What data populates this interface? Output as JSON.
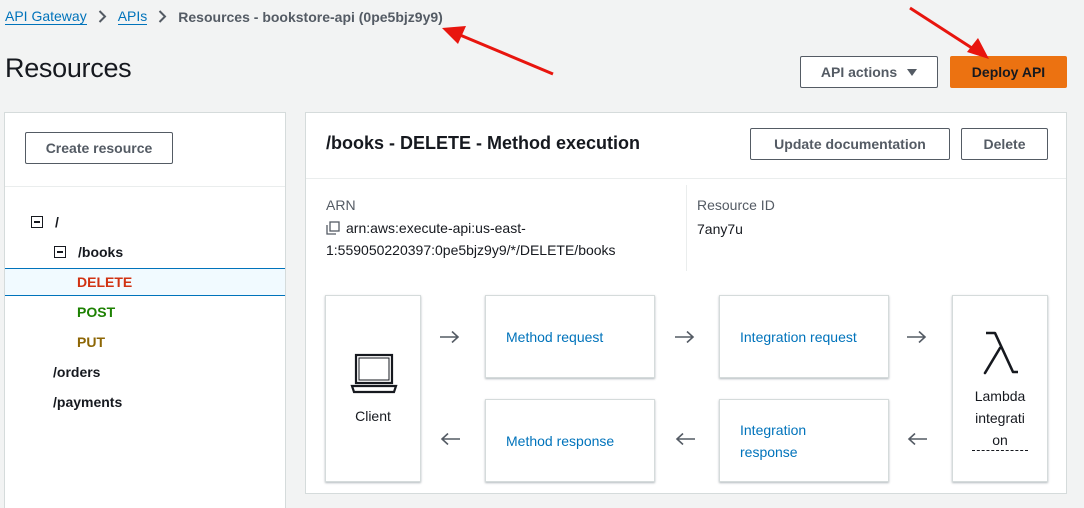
{
  "breadcrumb": {
    "items": [
      "API Gateway",
      "APIs"
    ],
    "current": "Resources - bookstore-api (0pe5bjz9y9)"
  },
  "page": {
    "title": "Resources"
  },
  "actions": {
    "api_actions": "API actions",
    "deploy": "Deploy API"
  },
  "left": {
    "create_resource": "Create resource",
    "tree": {
      "root": "/",
      "books": "/books",
      "delete": "DELETE",
      "post": "POST",
      "put": "PUT",
      "orders": "/orders",
      "payments": "/payments"
    }
  },
  "method": {
    "title": "/books - DELETE - Method execution",
    "update_doc": "Update documentation",
    "delete": "Delete",
    "arn_label": "ARN",
    "arn_line1": "arn:aws:execute-api:us-east-",
    "arn_line2": "1:559050220397:0pe5bjz9y9/*/DELETE/books",
    "resource_id_label": "Resource ID",
    "resource_id": "7any7u"
  },
  "flow": {
    "client": "Client",
    "method_request": "Method request",
    "integration_request": "Integration request",
    "method_response": "Method response",
    "integration_response_1": "Integration",
    "integration_response_2": "response",
    "lambda_1": "Lambda",
    "lambda_2": "integrati",
    "lambda_3": "on"
  },
  "colors": {
    "link": "#0073bb",
    "deploy_button": "#ec7211",
    "delete_method": "#d13212",
    "post_method": "#1d8102",
    "put_method": "#8d6605",
    "annotation_arrow": "#e8150e"
  },
  "icons": [
    "chevron-right-icon",
    "caret-down-icon",
    "copy-icon",
    "laptop-icon",
    "lambda-icon",
    "arrow-right-icon",
    "arrow-left-icon",
    "annotation-arrow"
  ]
}
